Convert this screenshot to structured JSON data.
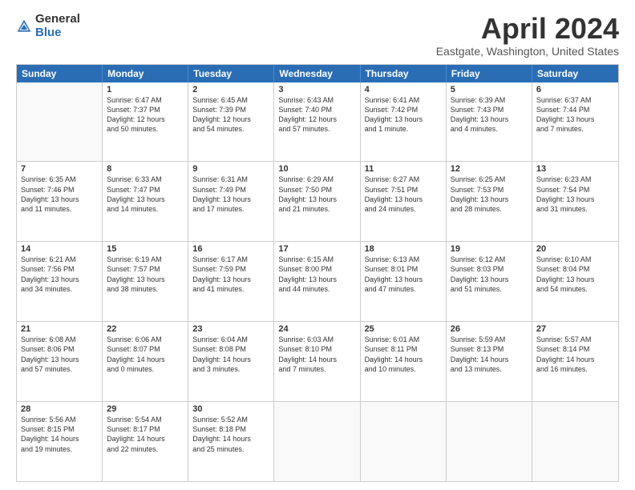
{
  "logo": {
    "general": "General",
    "blue": "Blue"
  },
  "title": "April 2024",
  "subtitle": "Eastgate, Washington, United States",
  "weekdays": [
    "Sunday",
    "Monday",
    "Tuesday",
    "Wednesday",
    "Thursday",
    "Friday",
    "Saturday"
  ],
  "rows": [
    [
      {
        "day": "",
        "lines": [],
        "empty": true
      },
      {
        "day": "1",
        "lines": [
          "Sunrise: 6:47 AM",
          "Sunset: 7:37 PM",
          "Daylight: 12 hours",
          "and 50 minutes."
        ]
      },
      {
        "day": "2",
        "lines": [
          "Sunrise: 6:45 AM",
          "Sunset: 7:39 PM",
          "Daylight: 12 hours",
          "and 54 minutes."
        ]
      },
      {
        "day": "3",
        "lines": [
          "Sunrise: 6:43 AM",
          "Sunset: 7:40 PM",
          "Daylight: 12 hours",
          "and 57 minutes."
        ]
      },
      {
        "day": "4",
        "lines": [
          "Sunrise: 6:41 AM",
          "Sunset: 7:42 PM",
          "Daylight: 13 hours",
          "and 1 minute."
        ]
      },
      {
        "day": "5",
        "lines": [
          "Sunrise: 6:39 AM",
          "Sunset: 7:43 PM",
          "Daylight: 13 hours",
          "and 4 minutes."
        ]
      },
      {
        "day": "6",
        "lines": [
          "Sunrise: 6:37 AM",
          "Sunset: 7:44 PM",
          "Daylight: 13 hours",
          "and 7 minutes."
        ]
      }
    ],
    [
      {
        "day": "7",
        "lines": [
          "Sunrise: 6:35 AM",
          "Sunset: 7:46 PM",
          "Daylight: 13 hours",
          "and 11 minutes."
        ]
      },
      {
        "day": "8",
        "lines": [
          "Sunrise: 6:33 AM",
          "Sunset: 7:47 PM",
          "Daylight: 13 hours",
          "and 14 minutes."
        ]
      },
      {
        "day": "9",
        "lines": [
          "Sunrise: 6:31 AM",
          "Sunset: 7:49 PM",
          "Daylight: 13 hours",
          "and 17 minutes."
        ]
      },
      {
        "day": "10",
        "lines": [
          "Sunrise: 6:29 AM",
          "Sunset: 7:50 PM",
          "Daylight: 13 hours",
          "and 21 minutes."
        ]
      },
      {
        "day": "11",
        "lines": [
          "Sunrise: 6:27 AM",
          "Sunset: 7:51 PM",
          "Daylight: 13 hours",
          "and 24 minutes."
        ]
      },
      {
        "day": "12",
        "lines": [
          "Sunrise: 6:25 AM",
          "Sunset: 7:53 PM",
          "Daylight: 13 hours",
          "and 28 minutes."
        ]
      },
      {
        "day": "13",
        "lines": [
          "Sunrise: 6:23 AM",
          "Sunset: 7:54 PM",
          "Daylight: 13 hours",
          "and 31 minutes."
        ]
      }
    ],
    [
      {
        "day": "14",
        "lines": [
          "Sunrise: 6:21 AM",
          "Sunset: 7:56 PM",
          "Daylight: 13 hours",
          "and 34 minutes."
        ]
      },
      {
        "day": "15",
        "lines": [
          "Sunrise: 6:19 AM",
          "Sunset: 7:57 PM",
          "Daylight: 13 hours",
          "and 38 minutes."
        ]
      },
      {
        "day": "16",
        "lines": [
          "Sunrise: 6:17 AM",
          "Sunset: 7:59 PM",
          "Daylight: 13 hours",
          "and 41 minutes."
        ]
      },
      {
        "day": "17",
        "lines": [
          "Sunrise: 6:15 AM",
          "Sunset: 8:00 PM",
          "Daylight: 13 hours",
          "and 44 minutes."
        ]
      },
      {
        "day": "18",
        "lines": [
          "Sunrise: 6:13 AM",
          "Sunset: 8:01 PM",
          "Daylight: 13 hours",
          "and 47 minutes."
        ]
      },
      {
        "day": "19",
        "lines": [
          "Sunrise: 6:12 AM",
          "Sunset: 8:03 PM",
          "Daylight: 13 hours",
          "and 51 minutes."
        ]
      },
      {
        "day": "20",
        "lines": [
          "Sunrise: 6:10 AM",
          "Sunset: 8:04 PM",
          "Daylight: 13 hours",
          "and 54 minutes."
        ]
      }
    ],
    [
      {
        "day": "21",
        "lines": [
          "Sunrise: 6:08 AM",
          "Sunset: 8:06 PM",
          "Daylight: 13 hours",
          "and 57 minutes."
        ]
      },
      {
        "day": "22",
        "lines": [
          "Sunrise: 6:06 AM",
          "Sunset: 8:07 PM",
          "Daylight: 14 hours",
          "and 0 minutes."
        ]
      },
      {
        "day": "23",
        "lines": [
          "Sunrise: 6:04 AM",
          "Sunset: 8:08 PM",
          "Daylight: 14 hours",
          "and 3 minutes."
        ]
      },
      {
        "day": "24",
        "lines": [
          "Sunrise: 6:03 AM",
          "Sunset: 8:10 PM",
          "Daylight: 14 hours",
          "and 7 minutes."
        ]
      },
      {
        "day": "25",
        "lines": [
          "Sunrise: 6:01 AM",
          "Sunset: 8:11 PM",
          "Daylight: 14 hours",
          "and 10 minutes."
        ]
      },
      {
        "day": "26",
        "lines": [
          "Sunrise: 5:59 AM",
          "Sunset: 8:13 PM",
          "Daylight: 14 hours",
          "and 13 minutes."
        ]
      },
      {
        "day": "27",
        "lines": [
          "Sunrise: 5:57 AM",
          "Sunset: 8:14 PM",
          "Daylight: 14 hours",
          "and 16 minutes."
        ]
      }
    ],
    [
      {
        "day": "28",
        "lines": [
          "Sunrise: 5:56 AM",
          "Sunset: 8:15 PM",
          "Daylight: 14 hours",
          "and 19 minutes."
        ]
      },
      {
        "day": "29",
        "lines": [
          "Sunrise: 5:54 AM",
          "Sunset: 8:17 PM",
          "Daylight: 14 hours",
          "and 22 minutes."
        ]
      },
      {
        "day": "30",
        "lines": [
          "Sunrise: 5:52 AM",
          "Sunset: 8:18 PM",
          "Daylight: 14 hours",
          "and 25 minutes."
        ]
      },
      {
        "day": "",
        "lines": [],
        "empty": true
      },
      {
        "day": "",
        "lines": [],
        "empty": true
      },
      {
        "day": "",
        "lines": [],
        "empty": true
      },
      {
        "day": "",
        "lines": [],
        "empty": true
      }
    ]
  ]
}
